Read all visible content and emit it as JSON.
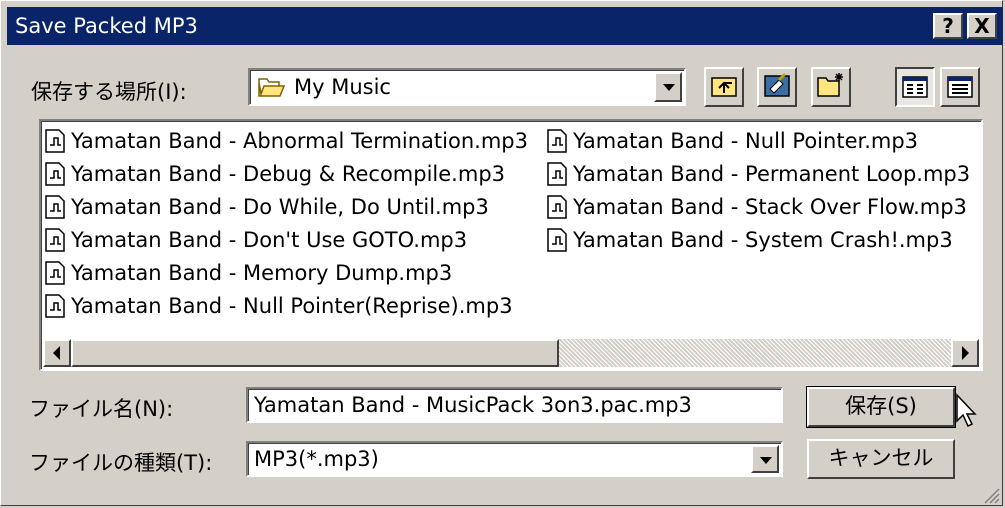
{
  "window": {
    "title": "Save Packed MP3",
    "help_label": "?",
    "close_label": "X"
  },
  "location": {
    "label": "保存する場所(I):",
    "value": "My Music"
  },
  "files": [
    "Yamatan Band - Abnormal Termination.mp3",
    "Yamatan Band - Debug & Recompile.mp3",
    "Yamatan Band - Do While, Do Until.mp3",
    "Yamatan Band - Don't Use GOTO.mp3",
    "Yamatan Band - Memory Dump.mp3",
    "Yamatan Band - Null Pointer(Reprise).mp3",
    "Yamatan Band - Null Pointer.mp3",
    "Yamatan Band - Permanent Loop.mp3",
    "Yamatan Band - Stack Over Flow.mp3",
    "Yamatan Band - System Crash!.mp3"
  ],
  "filename": {
    "label": "ファイル名(N):",
    "value": "Yamatan Band - MusicPack 3on3.pac.mp3"
  },
  "filetype": {
    "label": "ファイルの種類(T):",
    "value": "MP3(*.mp3)"
  },
  "buttons": {
    "save": "保存(S)",
    "cancel": "キャンセル"
  },
  "icons": {
    "toolbar": [
      "up-one-level-icon",
      "desktop-icon",
      "new-folder-icon",
      "list-view-icon",
      "details-view-icon"
    ],
    "file": "audio-file-icon",
    "folder": "folder-icon"
  },
  "colors": {
    "titlebar": "#0a246a",
    "face": "#d4d0c8"
  }
}
